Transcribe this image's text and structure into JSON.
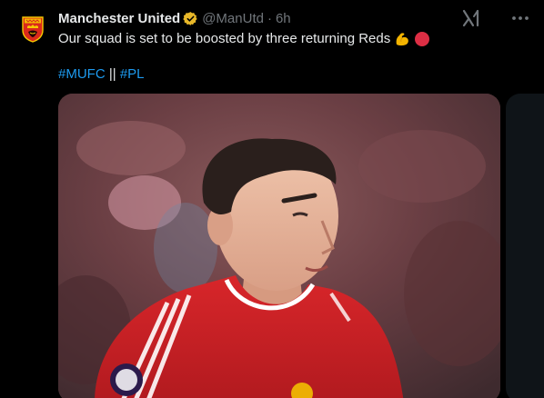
{
  "author": {
    "display_name": "Manchester United",
    "handle": "@ManUtd",
    "separator": "·",
    "time": "6h",
    "verified_icon": "verified-badge-icon",
    "avatar_icon": "club-crest-icon"
  },
  "tweet": {
    "text": "Our squad is set to be boosted by three returning Reds",
    "emojis": [
      "flexed-biceps-emoji",
      "red-circle-emoji"
    ],
    "hashtags": [
      "#MUFC",
      "#PL"
    ],
    "hashtag_separator": "||"
  },
  "actions": {
    "grok_icon": "grok-icon",
    "more_icon": "more-options-icon"
  },
  "media": {
    "image_icon": "player-photo-image"
  },
  "colors": {
    "background": "#000000",
    "text": "#e7e9ea",
    "muted": "#71767b",
    "link": "#1d9bf0",
    "verified_gold": "#e8b829",
    "club_red": "#da291c"
  }
}
